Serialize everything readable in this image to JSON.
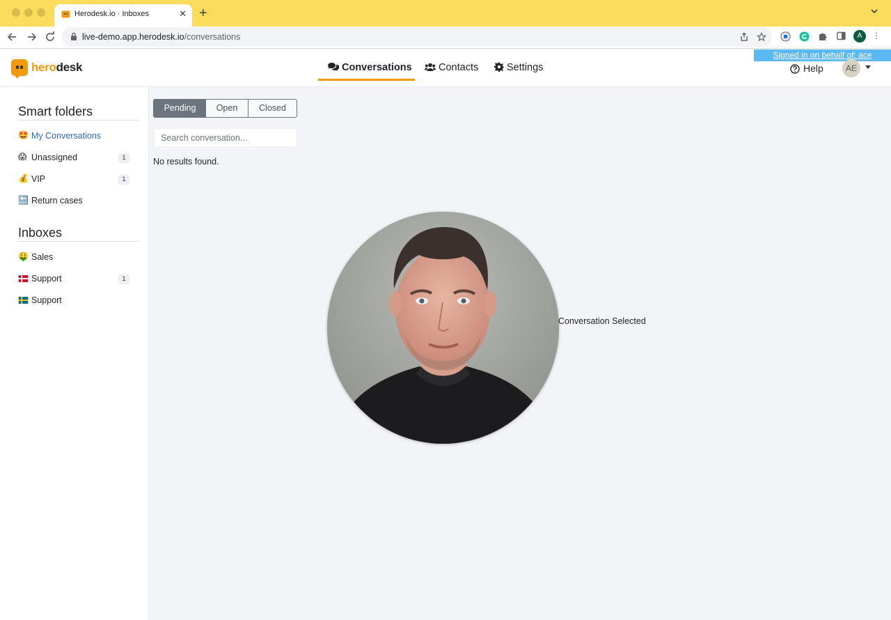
{
  "browser": {
    "tab_title": "Herodesk.io · Inboxes",
    "url_host": "live-demo.app.herodesk.io",
    "url_path": "/conversations",
    "profile_initial": "A"
  },
  "header": {
    "logo_hero": "hero",
    "logo_desk": "desk",
    "nav": {
      "conversations": "Conversations",
      "contacts": "Contacts",
      "settings": "Settings"
    },
    "signed_in_banner": "Signed in on behalf of: ace",
    "help": "Help",
    "avatar_initials": "AE"
  },
  "sidebar": {
    "smart_folders_title": "Smart folders",
    "smart_folders": [
      {
        "emoji": "🤩",
        "label": "My Conversations",
        "badge": ""
      },
      {
        "emoji": "😱",
        "label": "Unassigned",
        "badge": "1"
      },
      {
        "emoji": "💰",
        "label": "VIP",
        "badge": "1"
      },
      {
        "emoji": "🔙",
        "label": "Return cases",
        "badge": ""
      }
    ],
    "inboxes_title": "Inboxes",
    "inboxes": [
      {
        "emoji": "🤑",
        "label": "Sales",
        "badge": ""
      },
      {
        "emoji": "🇩🇰",
        "label": "Support",
        "badge": "1"
      },
      {
        "emoji": "🇸🇪",
        "label": "Support",
        "badge": ""
      }
    ]
  },
  "main": {
    "status_tabs": [
      "Pending",
      "Open",
      "Closed"
    ],
    "active_status_tab": "Pending",
    "search_placeholder": "Search conversation...",
    "no_results": "No results found.",
    "conversation_selected": "Conversation Selected"
  },
  "colors": {
    "brand": "#f29a0e",
    "tabbar": "#fbdc5c",
    "banner": "#5cb8f0",
    "active_link": "#2d6cc3",
    "segment_active": "#6c757d"
  }
}
